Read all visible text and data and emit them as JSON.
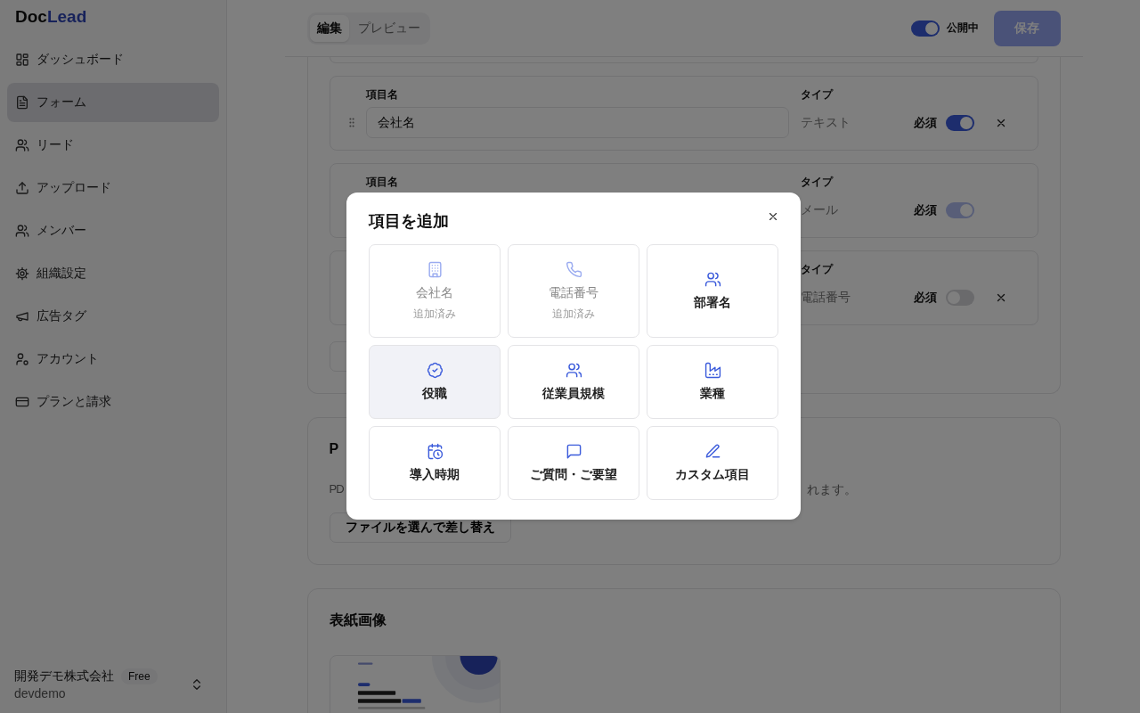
{
  "sidebar": {
    "logo": {
      "first": "Doc",
      "second": "Lead"
    },
    "nav": [
      {
        "label": "ダッシュボード",
        "selected": false
      },
      {
        "label": "フォーム",
        "selected": true
      },
      {
        "label": "リード",
        "selected": false
      },
      {
        "label": "アップロード",
        "selected": false
      },
      {
        "label": "メンバー",
        "selected": false
      },
      {
        "label": "組織設定",
        "selected": false
      },
      {
        "label": "広告タグ",
        "selected": false
      },
      {
        "label": "アカウント",
        "selected": false
      },
      {
        "label": "プランと請求",
        "selected": false
      }
    ],
    "org": {
      "name": "開発デモ株式会社",
      "plan": "Free",
      "slug": "devdemo"
    }
  },
  "topbar": {
    "tabs": [
      {
        "label": "編集",
        "selected": true
      },
      {
        "label": "プレビュー",
        "selected": false
      }
    ],
    "publish": {
      "label": "公開中",
      "on": true
    },
    "save": {
      "label": "保存",
      "disabled": true
    }
  },
  "fields": [
    {
      "label": "項目名",
      "value": "会社名",
      "type_label": "タイプ",
      "type": "テキスト",
      "required_label": "必須",
      "required": true,
      "required_disabled": false,
      "removable": true
    },
    {
      "label": "項目名",
      "type_label": "タイプ",
      "type": "メール",
      "required_label": "必須",
      "required": true,
      "required_disabled": true,
      "removable": false
    },
    {
      "type_label": "タイプ",
      "type": "電話番号",
      "required_label": "必須",
      "required": false,
      "required_disabled": false,
      "removable": true
    }
  ],
  "pdf_card": {
    "title": "P",
    "description_start": "PD",
    "description_end": "れます。",
    "button": "ファイルを選んで差し替え"
  },
  "cover_card": {
    "title": "表紙画像"
  },
  "modal": {
    "title": "項目を追加",
    "options": [
      {
        "label": "会社名",
        "note": "追加済み",
        "added": true,
        "hovered": false
      },
      {
        "label": "電話番号",
        "note": "追加済み",
        "added": true,
        "hovered": false
      },
      {
        "label": "部署名",
        "added": false,
        "hovered": false
      },
      {
        "label": "役職",
        "added": false,
        "hovered": true
      },
      {
        "label": "従業員規模",
        "added": false,
        "hovered": false
      },
      {
        "label": "業種",
        "added": false,
        "hovered": false
      },
      {
        "label": "導入時期",
        "added": false,
        "hovered": false
      },
      {
        "label": "ご質問・ご要望",
        "added": false,
        "hovered": false
      },
      {
        "label": "カスタム項目",
        "added": false,
        "hovered": false
      }
    ]
  }
}
